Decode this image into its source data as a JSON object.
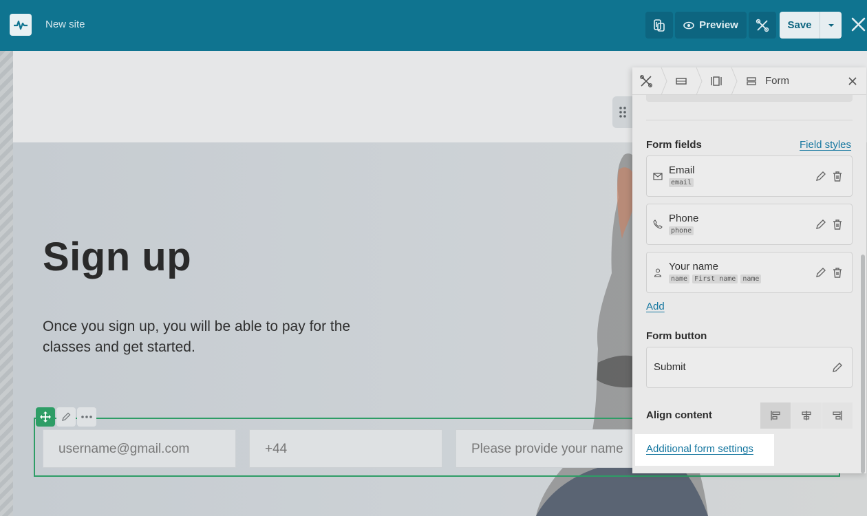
{
  "topbar": {
    "site_name": "New site",
    "preview_label": "Preview",
    "save_label": "Save"
  },
  "hero": {
    "title": "Sign up",
    "lead": "Once you sign up, you will be able to pay for the classes and get started."
  },
  "form": {
    "fields": [
      {
        "placeholder": "username@gmail.com"
      },
      {
        "placeholder": "+44"
      },
      {
        "placeholder": "Please provide your name"
      }
    ]
  },
  "panel": {
    "breadcrumb_label": "Form",
    "form_fields_title": "Form fields",
    "field_styles_link": "Field styles",
    "fields": [
      {
        "name": "Email",
        "tags": [
          "email"
        ],
        "icon": "envelope-icon"
      },
      {
        "name": "Phone",
        "tags": [
          "phone"
        ],
        "icon": "phone-icon"
      },
      {
        "name": "Your name",
        "tags": [
          "name",
          "First name",
          "name"
        ],
        "icon": "person-icon"
      }
    ],
    "add_link": "Add",
    "form_button_title": "Form button",
    "submit_label": "Submit",
    "align_title": "Align content",
    "align_selected": "left",
    "additional_settings_link": "Additional form settings"
  },
  "colors": {
    "topbar": "#0f7490",
    "accent_green": "#2e9d66",
    "link": "#1677a0"
  }
}
